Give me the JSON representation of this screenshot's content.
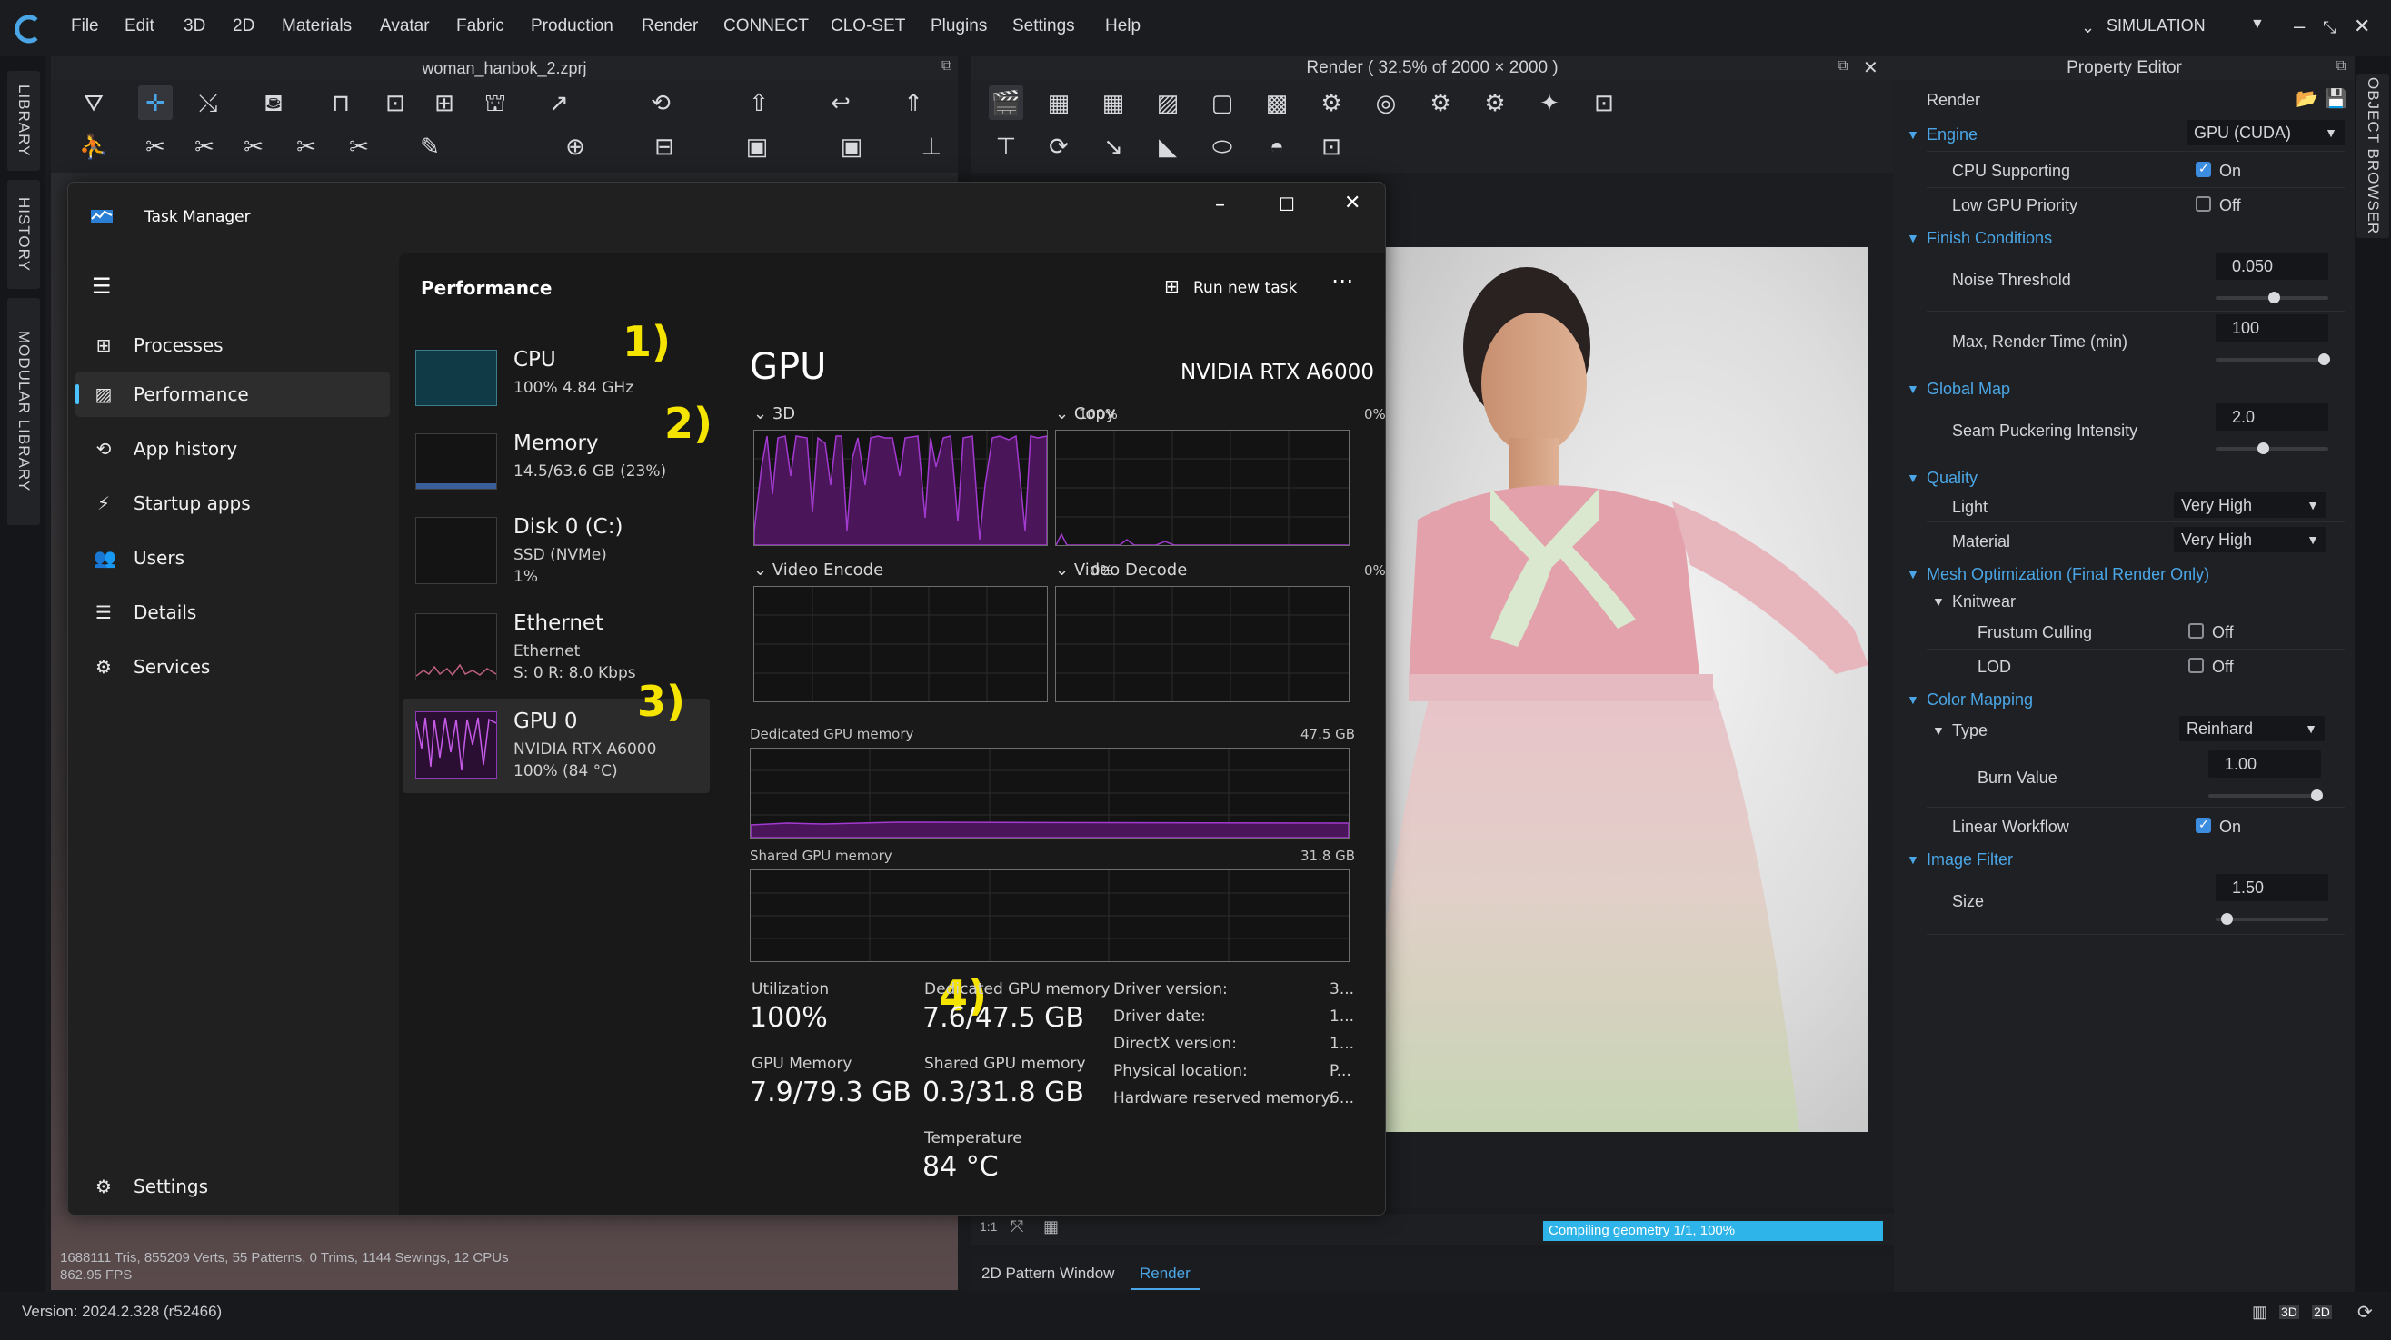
{
  "menubar": {
    "items": [
      "File",
      "Edit",
      "3D",
      "2D",
      "Materials",
      "Avatar",
      "Fabric",
      "Production",
      "Render",
      "CONNECT",
      "CLO-SET",
      "Plugins",
      "Settings",
      "Help"
    ],
    "mode": "SIMULATION"
  },
  "left_tabs": [
    "LIBRARY",
    "HISTORY",
    "MODULAR LIBRARY"
  ],
  "right_tabs": [
    "OBJECT BROWSER"
  ],
  "viewport3d": {
    "title": "woman_hanbok_2.zprj",
    "stats_line1": "1688111 Tris, 855209 Verts, 55 Patterns, 0 Trims, 1144 Sewings, 12 CPUs",
    "stats_line2": "862.95 FPS"
  },
  "render_window": {
    "title": "Render ( 32.5% of 2000 × 2000 )",
    "progress_text": "Compiling geometry 1/1, 100%",
    "bottom_tabs": [
      "2D Pattern Window",
      "Render"
    ]
  },
  "property_editor": {
    "title": "Property Editor",
    "render_label": "Render",
    "engine": {
      "label": "Engine",
      "value": "GPU (CUDA)"
    },
    "cpu_supporting": {
      "label": "CPU Supporting",
      "value": "On"
    },
    "low_gpu_priority": {
      "label": "Low GPU Priority",
      "value": "Off"
    },
    "finish_conditions": "Finish Conditions",
    "noise_threshold": {
      "label": "Noise Threshold",
      "value": "0.050",
      "level": 0.52
    },
    "max_render_time": {
      "label": "Max, Render Time (min)",
      "value": "100",
      "level": 0.96
    },
    "global_map": "Global Map",
    "seam_puckering": {
      "label": "Seam Puckering Intensity",
      "value": "2.0",
      "level": 0.42
    },
    "quality": "Quality",
    "light": {
      "label": "Light",
      "value": "Very High"
    },
    "material": {
      "label": "Material",
      "value": "Very High"
    },
    "mesh_optimization": "Mesh Optimization (Final Render Only)",
    "knitwear": "Knitwear",
    "frustum_culling": {
      "label": "Frustum Culling",
      "value": "Off"
    },
    "lod": {
      "label": "LOD",
      "value": "Off"
    },
    "color_mapping": "Color Mapping",
    "type": {
      "label": "Type",
      "value": "Reinhard"
    },
    "burn_value": {
      "label": "Burn Value",
      "value": "1.00",
      "level": 0.96
    },
    "linear_workflow": {
      "label": "Linear Workflow",
      "value": "On"
    },
    "image_filter": "Image Filter",
    "size": {
      "label": "Size",
      "value": "1.50",
      "level": 0.1
    }
  },
  "statusbar": {
    "version": "Version: 2024.2.328 (r52466)"
  },
  "task_manager": {
    "title": "Task Manager",
    "nav": [
      "Processes",
      "Performance",
      "App history",
      "Startup apps",
      "Users",
      "Details",
      "Services"
    ],
    "settings": "Settings",
    "header": "Performance",
    "run_new_task": "Run new task",
    "devices": [
      {
        "name": "CPU",
        "sub1": "100%  4.84 GHz",
        "sub2": "",
        "sub3": ""
      },
      {
        "name": "Memory",
        "sub1": "14.5/63.6 GB (23%)",
        "sub2": "",
        "sub3": ""
      },
      {
        "name": "Disk 0 (C:)",
        "sub1": "SSD (NVMe)",
        "sub2": "1%",
        "sub3": ""
      },
      {
        "name": "Ethernet",
        "sub1": "Ethernet",
        "sub2": "S: 0  R: 8.0 Kbps",
        "sub3": ""
      },
      {
        "name": "GPU 0",
        "sub1": "NVIDIA RTX A6000",
        "sub2": "100%  (84 °C)",
        "sub3": ""
      }
    ],
    "annotations": [
      "1)",
      "2)",
      "3)",
      "4)"
    ],
    "gpu": {
      "title": "GPU",
      "model": "NVIDIA RTX A6000",
      "graphs": [
        {
          "label": "3D",
          "pct": "100%"
        },
        {
          "label": "Copy",
          "pct": "0%"
        },
        {
          "label": "Video Encode",
          "pct": "0%"
        },
        {
          "label": "Video Decode",
          "pct": "0%"
        }
      ],
      "dedicated_label": "Dedicated GPU memory",
      "dedicated_max": "47.5 GB",
      "shared_label": "Shared GPU memory",
      "shared_max": "31.8 GB",
      "stats": {
        "utilization_label": "Utilization",
        "utilization": "100%",
        "gpu_memory_label": "GPU Memory",
        "gpu_memory": "7.9/79.3 GB",
        "dedicated_label": "Dedicated GPU memory",
        "dedicated": "7.6/47.5 GB",
        "shared_label": "Shared GPU memory",
        "shared": "0.3/31.8 GB",
        "temperature_label": "Temperature",
        "temperature": "84 °C"
      },
      "driver": [
        {
          "label": "Driver version:",
          "value": "3..."
        },
        {
          "label": "Driver date:",
          "value": "1..."
        },
        {
          "label": "DirectX version:",
          "value": "1..."
        },
        {
          "label": "Physical location:",
          "value": "P..."
        },
        {
          "label": "Hardware reserved memory:",
          "value": "6..."
        }
      ]
    }
  },
  "colors": {
    "accent": "#4aa6e6",
    "gpu_graph": "#a23ad0",
    "annotation": "#f5e400",
    "progress": "#2fb4ea"
  }
}
